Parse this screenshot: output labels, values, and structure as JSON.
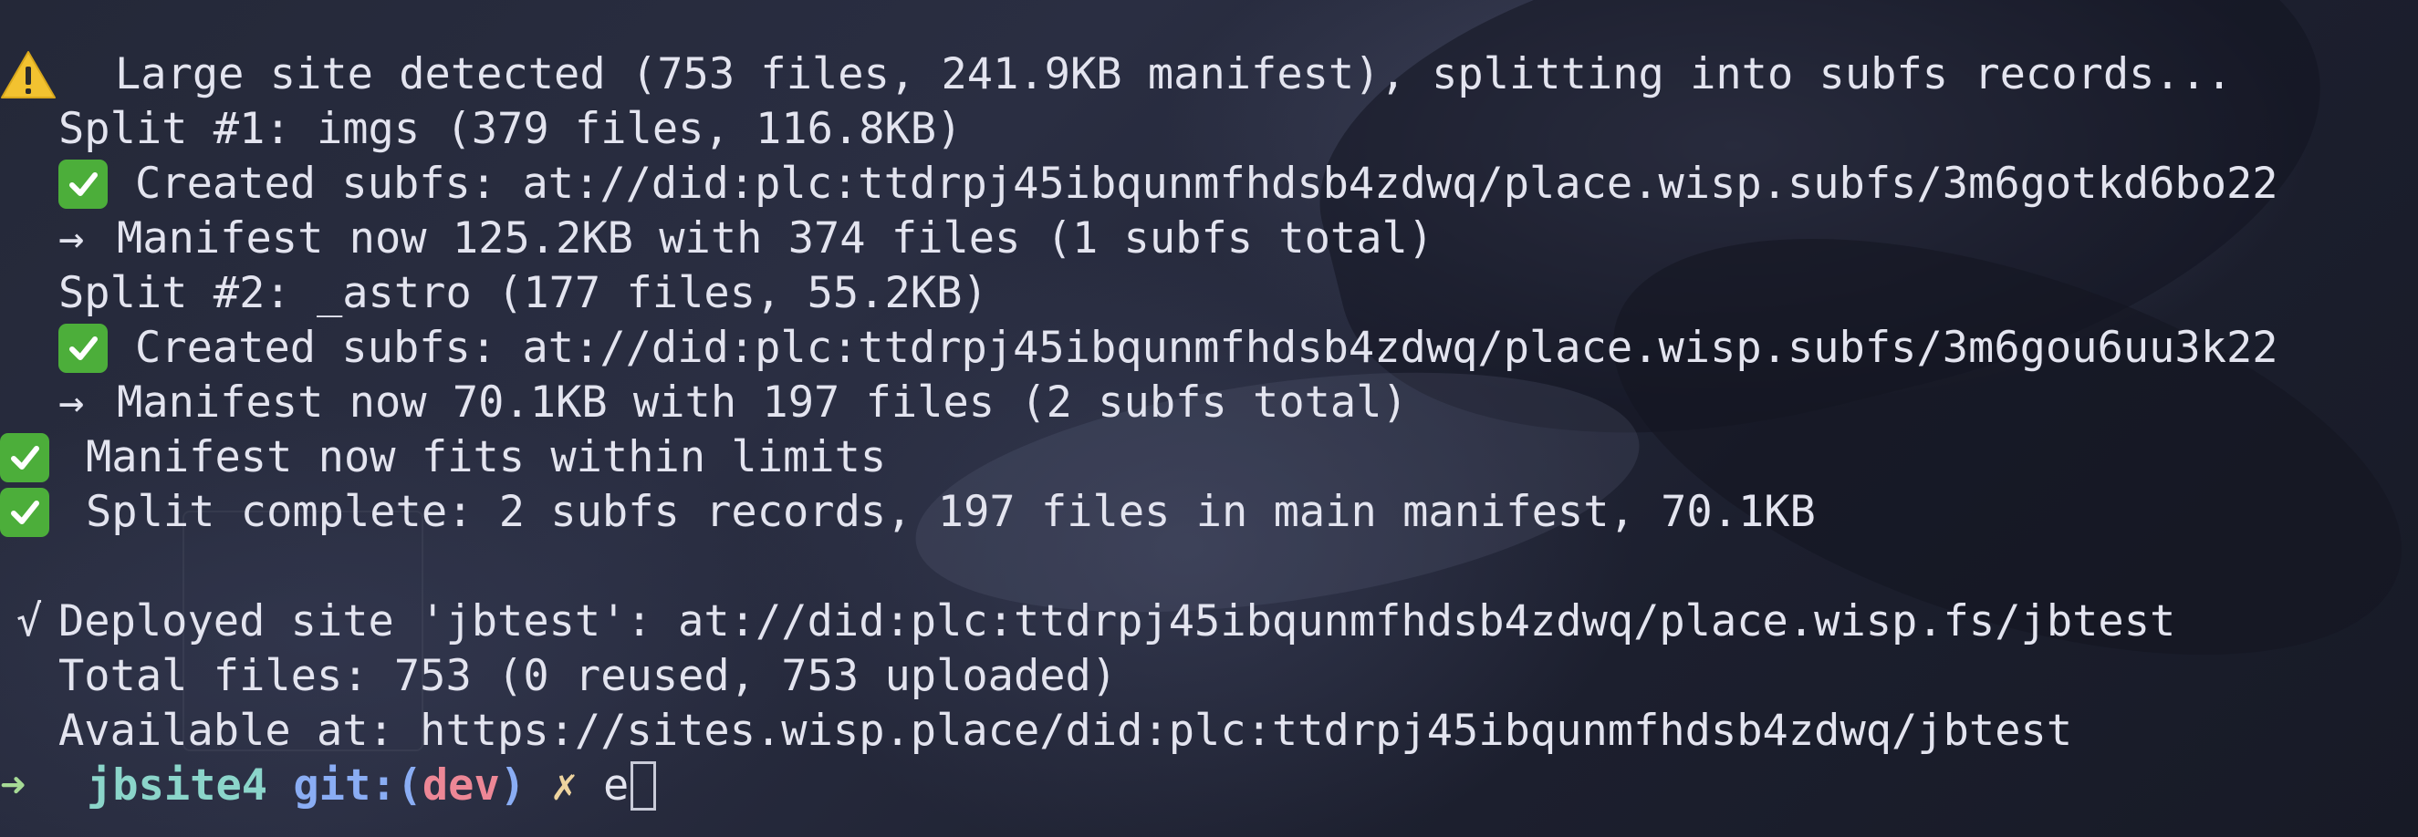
{
  "terminal": {
    "lines": [
      {
        "text": "Large site detected (753 files, 241.9KB manifest), splitting into subfs records..."
      },
      {
        "text": "Split #1: imgs (379 files, 116.8KB)"
      },
      {
        "text": "Created subfs: at://did:plc:ttdrpj45ibqunmfhdsb4zdwq/place.wisp.subfs/3m6gotkd6bo22"
      },
      {
        "text": "Manifest now 125.2KB with 374 files (1 subfs total)"
      },
      {
        "text": "Split #2: _astro (177 files, 55.2KB)"
      },
      {
        "text": "Created subfs: at://did:plc:ttdrpj45ibqunmfhdsb4zdwq/place.wisp.subfs/3m6gou6uu3k22"
      },
      {
        "text": "Manifest now 70.1KB with 197 files (2 subfs total)"
      },
      {
        "text": "Manifest now fits within limits"
      },
      {
        "text": "Split complete: 2 subfs records, 197 files in main manifest, 70.1KB"
      },
      {
        "text": "Deployed site 'jbtest': at://did:plc:ttdrpj45ibqunmfhdsb4zdwq/place.wisp.fs/jbtest"
      },
      {
        "text": "Total files: 753 (0 reused, 753 uploaded)"
      },
      {
        "text": "Available at: https://sites.wisp.place/did:plc:ttdrpj45ibqunmfhdsb4zdwq/jbtest"
      }
    ],
    "glyphs": {
      "arrow": "→",
      "tick": "√",
      "prompt_arrow": "➜"
    },
    "prompt": {
      "directory": "jbsite4",
      "git_label": "git:(",
      "branch": "dev",
      "git_close": ")",
      "dirty_mark": "✗",
      "input": "e"
    }
  },
  "colors": {
    "check_green": "#4cae3a",
    "warning_yellow": "#f2c230",
    "prompt_arrow": "#a6da95",
    "prompt_dir": "#8bd5ca",
    "prompt_git": "#8aadf4",
    "prompt_branch": "#ed8796",
    "prompt_dirty": "#eed49f"
  },
  "icons": [
    "warning-icon",
    "check-mark-icon",
    "arrow-right-icon",
    "checkmark-tick-icon",
    "prompt-arrow-icon",
    "text-cursor-icon"
  ]
}
